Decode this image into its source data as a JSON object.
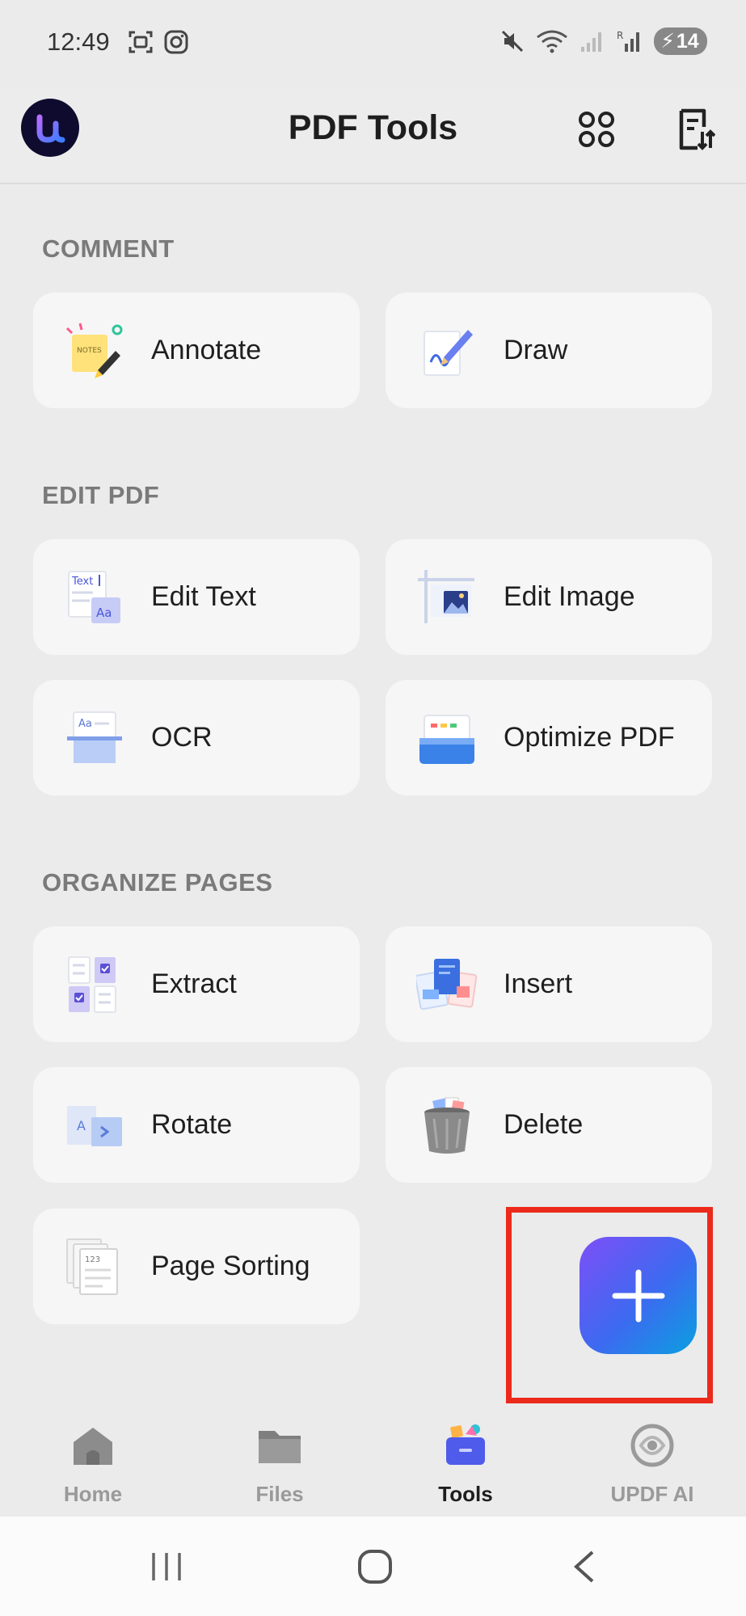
{
  "status": {
    "time": "12:49",
    "battery": "14",
    "signal_label": "R"
  },
  "header": {
    "title": "PDF Tools"
  },
  "sections": {
    "comment": {
      "title": "COMMENT",
      "items": [
        {
          "label": "Annotate",
          "icon": "annotate-icon"
        },
        {
          "label": "Draw",
          "icon": "draw-icon"
        }
      ]
    },
    "edit": {
      "title": "EDIT PDF",
      "items": [
        {
          "label": "Edit Text",
          "icon": "edit-text-icon"
        },
        {
          "label": "Edit Image",
          "icon": "edit-image-icon"
        },
        {
          "label": "OCR",
          "icon": "ocr-icon"
        },
        {
          "label": "Optimize PDF",
          "icon": "optimize-pdf-icon"
        }
      ]
    },
    "organize": {
      "title": "ORGANIZE PAGES",
      "items": [
        {
          "label": "Extract",
          "icon": "extract-icon"
        },
        {
          "label": "Insert",
          "icon": "insert-icon"
        },
        {
          "label": "Rotate",
          "icon": "rotate-icon"
        },
        {
          "label": "Delete",
          "icon": "delete-icon"
        },
        {
          "label": "Page Sorting",
          "icon": "page-sorting-icon"
        }
      ]
    }
  },
  "icon_text": {
    "annotate": "NOTES",
    "edit_text_top": "Text",
    "edit_text_bottom": "Aa",
    "ocr": "Aa",
    "rotate": "A",
    "page_sorting": "123"
  },
  "bottom_nav": {
    "items": [
      {
        "label": "Home",
        "icon": "home-icon",
        "active": false
      },
      {
        "label": "Files",
        "icon": "folder-icon",
        "active": false
      },
      {
        "label": "Tools",
        "icon": "tools-icon",
        "active": true
      },
      {
        "label": "UPDF AI",
        "icon": "ai-icon",
        "active": false
      }
    ]
  },
  "colors": {
    "accent": "#5b5ff0",
    "highlight_border": "#ec2a1c",
    "fab_gradient_start": "#7e4ff7",
    "fab_gradient_end": "#0aa0e0"
  }
}
